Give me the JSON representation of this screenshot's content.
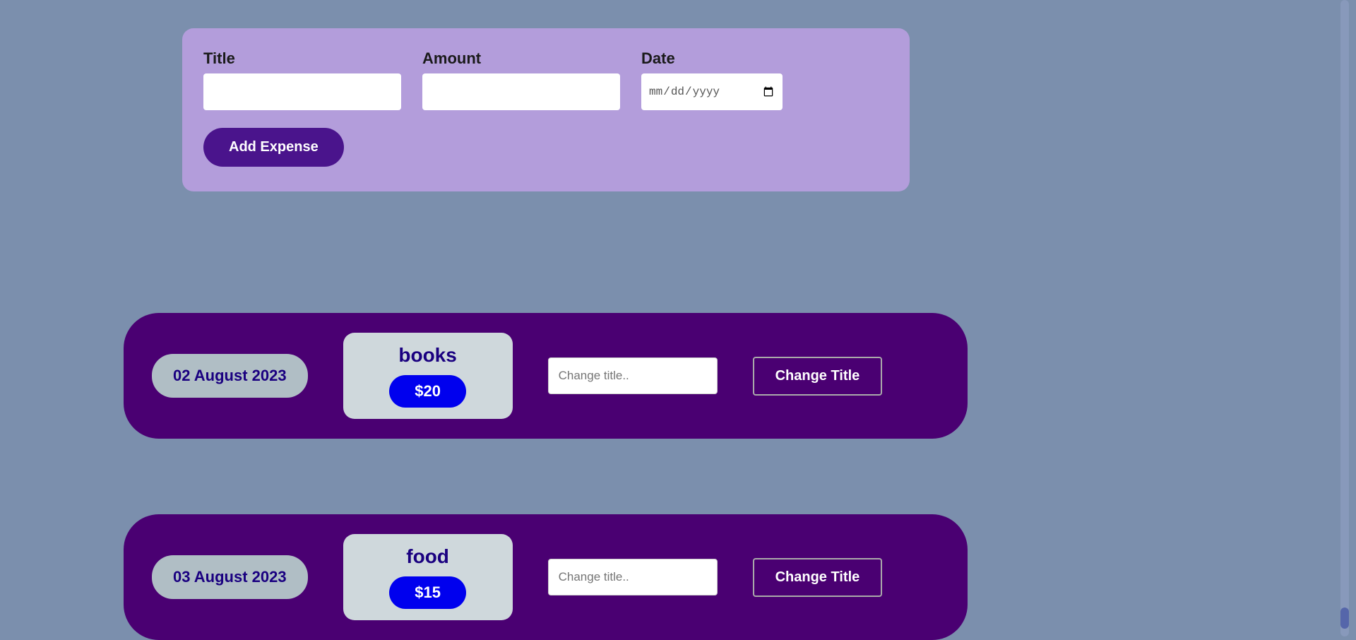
{
  "background_color": "#7b8fad",
  "form": {
    "title_label": "Title",
    "title_placeholder": "",
    "amount_label": "Amount",
    "amount_placeholder": "",
    "date_label": "Date",
    "date_placeholder": "dd-mm-yyyy",
    "add_button_label": "Add Expense"
  },
  "expense_items": [
    {
      "date": "02 August 2023",
      "title": "books",
      "amount": "$20",
      "change_title_placeholder": "Change title..",
      "change_title_button": "Change Title"
    },
    {
      "date": "03 August 2023",
      "title": "food",
      "amount": "$15",
      "change_title_placeholder": "Change title..",
      "change_title_button": "Change Title"
    }
  ]
}
